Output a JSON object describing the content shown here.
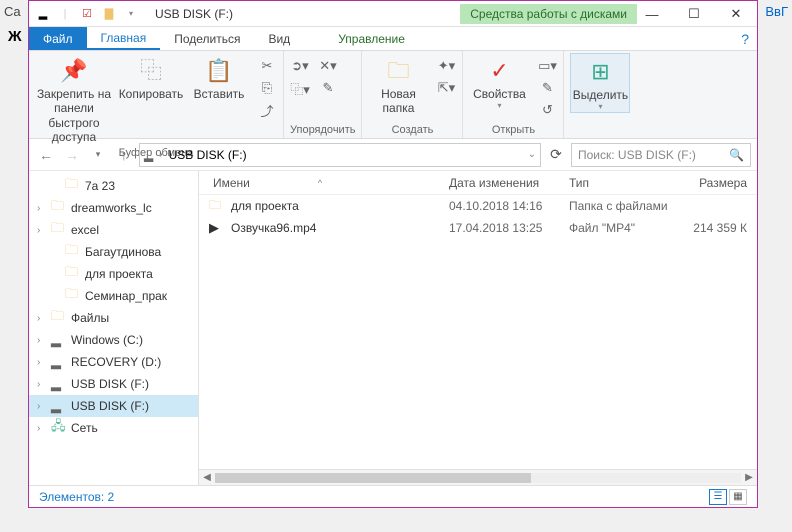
{
  "bg": {
    "left": "Ca",
    "right": "ВвГ",
    "bold": "Ж"
  },
  "title": "USB DISK (F:)",
  "context_tab": "Средства работы с дисками",
  "tabs": {
    "file": "Файл",
    "home": "Главная",
    "share": "Поделиться",
    "view": "Вид",
    "manage": "Управление"
  },
  "ribbon": {
    "pin": "Закрепить на панели\nбыстрого доступа",
    "copy": "Копировать",
    "paste": "Вставить",
    "clipboard_group": "Буфер обмена",
    "organize_group": "Упорядочить",
    "newfolder": "Новая\nпапка",
    "create_group": "Создать",
    "properties": "Свойства",
    "open_group": "Открыть",
    "select": "Выделить",
    "select_group": ""
  },
  "address": {
    "path": "USB DISK (F:)"
  },
  "search": {
    "placeholder": "Поиск: USB DISK (F:)"
  },
  "tree": [
    {
      "indent": 1,
      "exp": "",
      "icon": "folder",
      "label": "7а 23"
    },
    {
      "indent": 0,
      "exp": "›",
      "icon": "folder",
      "label": "dreamworks_lc"
    },
    {
      "indent": 0,
      "exp": "›",
      "icon": "folder",
      "label": "excel"
    },
    {
      "indent": 1,
      "exp": "",
      "icon": "folder",
      "label": "Багаутдинова"
    },
    {
      "indent": 1,
      "exp": "",
      "icon": "folder",
      "label": "для проекта"
    },
    {
      "indent": 1,
      "exp": "",
      "icon": "folder",
      "label": "Семинар_прак"
    },
    {
      "indent": 0,
      "exp": "›",
      "icon": "folder",
      "label": "Файлы"
    },
    {
      "indent": 0,
      "exp": "›",
      "icon": "drive",
      "label": "Windows (C:)"
    },
    {
      "indent": 0,
      "exp": "›",
      "icon": "drive",
      "label": "RECOVERY (D:)"
    },
    {
      "indent": 0,
      "exp": "›",
      "icon": "drive",
      "label": "USB DISK (F:)"
    },
    {
      "indent": 0,
      "exp": "›",
      "icon": "drive",
      "label": "USB DISK (F:)",
      "sel": true
    },
    {
      "indent": 0,
      "exp": "›",
      "icon": "net",
      "label": "Сеть"
    }
  ],
  "columns": {
    "name": "Имени",
    "date": "Дата изменения",
    "type": "Тип",
    "size": "Размера"
  },
  "rows": [
    {
      "icon": "folder",
      "name": "для проекта",
      "date": "04.10.2018 14:16",
      "type": "Папка с файлами",
      "size": ""
    },
    {
      "icon": "video",
      "name": "Озвучка96.mp4",
      "date": "17.04.2018 13:25",
      "type": "Файл \"MP4\"",
      "size": "214 359 К"
    }
  ],
  "status": "Элементов: 2"
}
